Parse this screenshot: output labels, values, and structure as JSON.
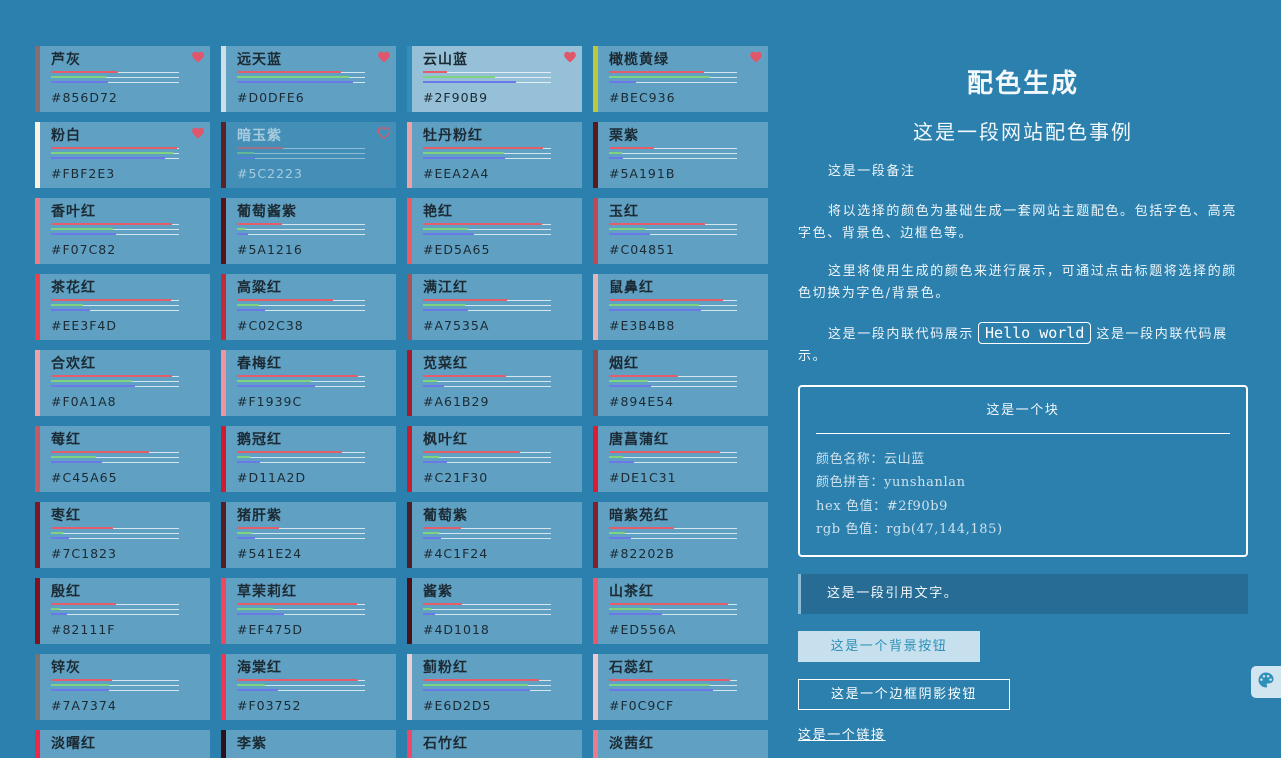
{
  "theme": {
    "page_background": "#2b80ae",
    "accent": "#2f90b9",
    "heart_color": "#e0566a",
    "button_background": "#c6e0ee",
    "quote_background": "#276c94",
    "muted_text": "#cfe1ec"
  },
  "palette": {
    "cards": [
      {
        "name": "芦灰",
        "hex": "#856D72",
        "icon": "heart-filled-icon"
      },
      {
        "name": "远天蓝",
        "hex": "#D0DFE6",
        "icon": "heart-filled-icon"
      },
      {
        "name": "云山蓝",
        "hex": "#2F90B9",
        "icon": "heart-filled-icon",
        "selected": true
      },
      {
        "name": "橄榄黄绿",
        "hex": "#BEC936",
        "icon": "heart-filled-icon"
      },
      {
        "name": "粉白",
        "hex": "#FBF2E3",
        "icon": "heart-filled-icon"
      },
      {
        "name": "暗玉紫",
        "hex": "#5C2223",
        "icon": "heart-outline-icon",
        "hovered": true
      },
      {
        "name": "牡丹粉红",
        "hex": "#EEA2A4"
      },
      {
        "name": "栗紫",
        "hex": "#5A191B"
      },
      {
        "name": "香叶红",
        "hex": "#F07C82"
      },
      {
        "name": "葡萄酱紫",
        "hex": "#5A1216"
      },
      {
        "name": "艳红",
        "hex": "#ED5A65"
      },
      {
        "name": "玉红",
        "hex": "#C04851"
      },
      {
        "name": "茶花红",
        "hex": "#EE3F4D"
      },
      {
        "name": "高粱红",
        "hex": "#C02C38"
      },
      {
        "name": "满江红",
        "hex": "#A7535A"
      },
      {
        "name": "鼠鼻红",
        "hex": "#E3B4B8"
      },
      {
        "name": "合欢红",
        "hex": "#F0A1A8"
      },
      {
        "name": "春梅红",
        "hex": "#F1939C"
      },
      {
        "name": "苋菜红",
        "hex": "#A61B29"
      },
      {
        "name": "烟红",
        "hex": "#894E54"
      },
      {
        "name": "莓红",
        "hex": "#C45A65"
      },
      {
        "name": "鹅冠红",
        "hex": "#D11A2D"
      },
      {
        "name": "枫叶红",
        "hex": "#C21F30"
      },
      {
        "name": "唐菖蒲红",
        "hex": "#DE1C31"
      },
      {
        "name": "枣红",
        "hex": "#7C1823"
      },
      {
        "name": "猪肝紫",
        "hex": "#541E24"
      },
      {
        "name": "葡萄紫",
        "hex": "#4C1F24"
      },
      {
        "name": "暗紫苑红",
        "hex": "#82202B"
      },
      {
        "name": "殷红",
        "hex": "#82111F"
      },
      {
        "name": "草茉莉红",
        "hex": "#EF475D"
      },
      {
        "name": "酱紫",
        "hex": "#4D1018"
      },
      {
        "name": "山茶红",
        "hex": "#ED556A"
      },
      {
        "name": "锌灰",
        "hex": "#7A7374"
      },
      {
        "name": "海棠红",
        "hex": "#F03752"
      },
      {
        "name": "蓟粉红",
        "hex": "#E6D2D5"
      },
      {
        "name": "石蕊红",
        "hex": "#F0C9CF"
      },
      {
        "name": "淡曙红",
        "color": "#EE2746"
      },
      {
        "name": "李紫",
        "color": "#2B1216"
      },
      {
        "name": "石竹红",
        "color": "#EE4866"
      },
      {
        "name": "淡茜红",
        "color": "#E77C8E"
      }
    ]
  },
  "panel": {
    "title": "配色生成",
    "subtitle": "这是一段网站配色事例",
    "note": "这是一段备注",
    "intro": "将以选择的颜色为基础生成一套网站主题配色。包括字色、高亮字色、背景色、边框色等。",
    "usage": "这里将使用生成的颜色来进行展示，可通过点击标题将选择的颜色切换为字色/背景色。",
    "inline_code_lead": "这是一段内联代码展示",
    "inline_code": "Hello world",
    "inline_code_tail": "这是一段内联代码展示。",
    "block": {
      "title": "这是一个块",
      "rows": [
        {
          "label": "颜色名称：",
          "value": "云山蓝"
        },
        {
          "label": "颜色拼音：",
          "value": "yunshanlan"
        },
        {
          "label": "hex 色值：",
          "value": "#2f90b9"
        },
        {
          "label": "rgb 色值：",
          "value": "rgb(47,144,185)"
        }
      ]
    },
    "quote": "这是一段引用文字。",
    "background_button": "这是一个背景按钮",
    "border_shadow_button": "这是一个边框阴影按钮",
    "link": "这是一个链接"
  },
  "floating_button": {
    "icon": "palette-icon"
  }
}
